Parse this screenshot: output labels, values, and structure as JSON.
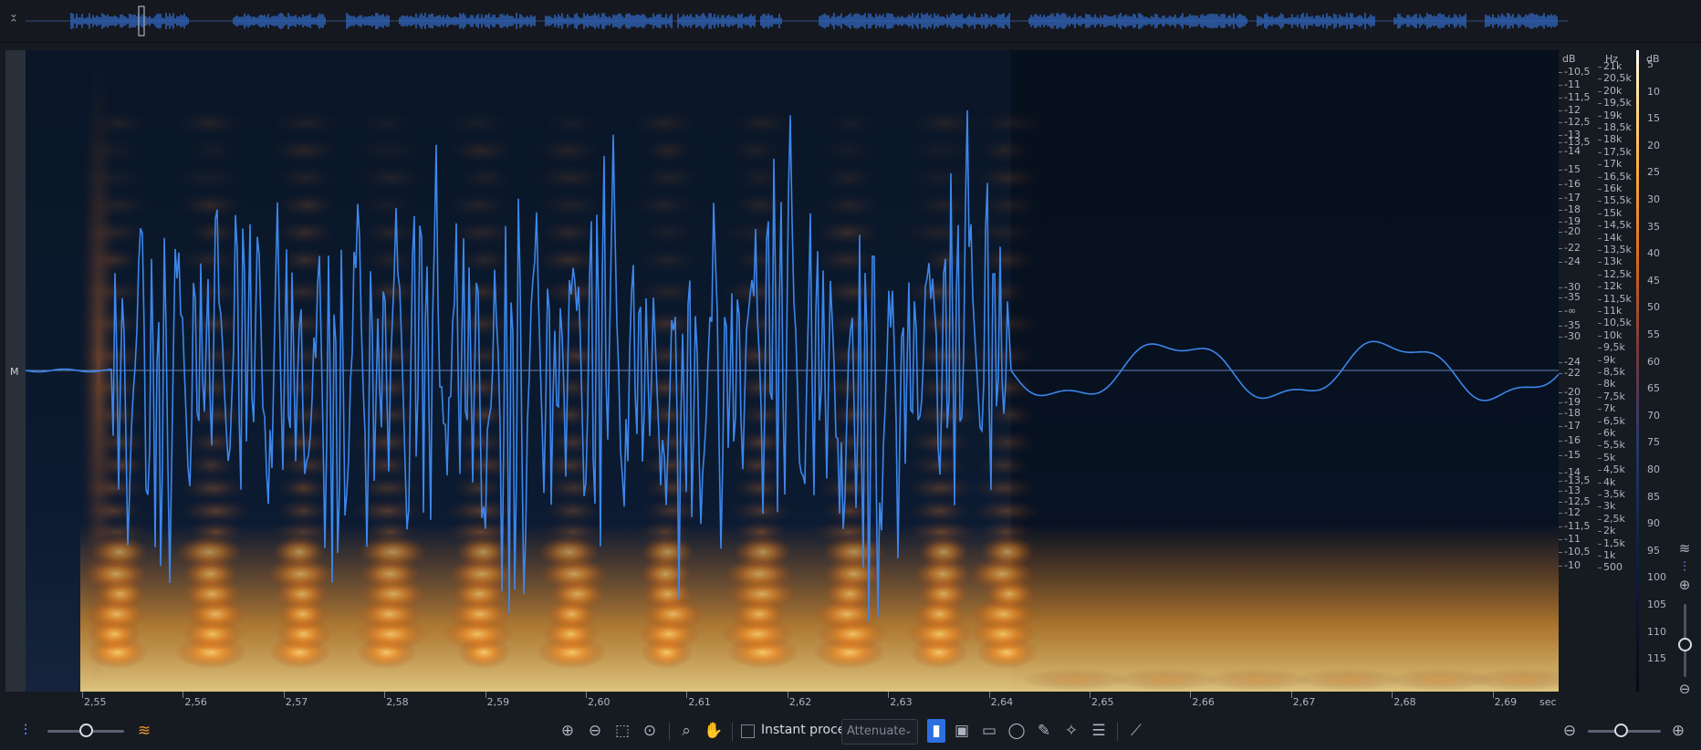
{
  "overview": {
    "collapse_icon": "collapse-arrows-icon"
  },
  "channel": {
    "label": "M"
  },
  "rulers": {
    "db": {
      "unit": "dB",
      "upper_labels": [
        "-10,5",
        "-11",
        "-11,5",
        "-12",
        "-12,5",
        "-13",
        "-13,5",
        "-14",
        "-15",
        "-16",
        "-17",
        "-18",
        "-19",
        "-20",
        "-22",
        "-24",
        "-30",
        "-35"
      ],
      "center_label": "-∞",
      "lower_labels": [
        "-35",
        "-30",
        "-24",
        "-22",
        "-20",
        "-19",
        "-18",
        "-17",
        "-16",
        "-15",
        "-14",
        "-13,5",
        "-13",
        "-12,5",
        "-12",
        "-11,5",
        "-11",
        "-10,5",
        "-10"
      ]
    },
    "hz": {
      "unit": "Hz",
      "labels": [
        "21k",
        "20,5k",
        "20k",
        "19,5k",
        "19k",
        "18,5k",
        "18k",
        "17,5k",
        "17k",
        "16,5k",
        "16k",
        "15,5k",
        "15k",
        "14,5k",
        "14k",
        "13,5k",
        "13k",
        "12,5k",
        "12k",
        "11,5k",
        "11k",
        "10,5k",
        "10k",
        "9,5k",
        "9k",
        "8,5k",
        "8k",
        "7,5k",
        "7k",
        "6,5k",
        "6k",
        "5,5k",
        "5k",
        "4,5k",
        "4k",
        "3,5k",
        "3k",
        "2,5k",
        "2k",
        "1,5k",
        "1k",
        "500"
      ]
    },
    "color": {
      "unit": "dB",
      "labels": [
        "5",
        "10",
        "15",
        "20",
        "25",
        "30",
        "35",
        "40",
        "45",
        "50",
        "55",
        "60",
        "65",
        "70",
        "75",
        "80",
        "85",
        "90",
        "95",
        "100",
        "105",
        "110",
        "115"
      ]
    },
    "time": {
      "unit": "sec",
      "labels": [
        "2,55",
        "2,56",
        "2,57",
        "2,58",
        "2,59",
        "2,60",
        "2,61",
        "2,62",
        "2,63",
        "2,64",
        "2,65",
        "2,66",
        "2,67",
        "2,68",
        "2,69"
      ]
    }
  },
  "right_tools": {
    "waveform_icon": "waveform-toggle-icon",
    "spectrogram_icon": "spectrogram-toggle-icon",
    "zoom_in_icon": "zoom-in-icon",
    "zoom_out_icon": "zoom-out-icon",
    "vertical_zoom": 0.55
  },
  "bottom": {
    "waveform_blend": 0.5,
    "instant_process_label": "Instant process",
    "instant_process_checked": false,
    "mode_value": "Attenuate",
    "horizontal_zoom": 0.45,
    "tools": [
      "zoom-in-icon",
      "zoom-out-icon",
      "zoom-selection-icon",
      "zoom-fit-icon",
      "magnify-icon",
      "hand-icon",
      "time-selection-icon",
      "time-frequency-selection-icon",
      "frequency-selection-icon",
      "lasso-icon",
      "brush-icon",
      "magic-wand-icon",
      "harmonic-selection-icon",
      "envelope-icon"
    ]
  },
  "colors": {
    "accent": "#2c6fe0",
    "waveform": "#3d86ea",
    "spectro_hot": "#ffb040",
    "spectro_cold": "#06101d"
  }
}
